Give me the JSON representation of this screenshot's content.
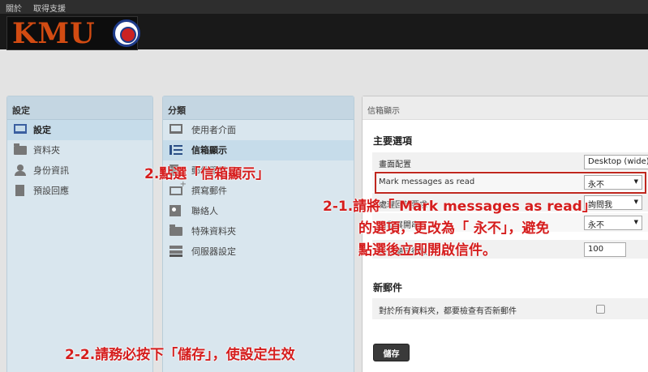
{
  "topbar": {
    "about": "關於",
    "support": "取得支援"
  },
  "logo": {
    "text": "KMU"
  },
  "settings_panel": {
    "title": "設定",
    "items": [
      {
        "label": "設定",
        "icon": "monitor-icon",
        "active": true
      },
      {
        "label": "資料夾",
        "icon": "folder-icon"
      },
      {
        "label": "身份資訊",
        "icon": "person-icon"
      },
      {
        "label": "預設回應",
        "icon": "document-icon"
      }
    ]
  },
  "sections_panel": {
    "title": "分類",
    "items": [
      {
        "label": "使用者介面",
        "icon": "monitor-icon"
      },
      {
        "label": "信箱顯示",
        "icon": "list-icon",
        "active": true
      },
      {
        "label": "郵件顯示",
        "icon": "document-icon"
      },
      {
        "label": "撰寫郵件",
        "icon": "compose-mail-icon"
      },
      {
        "label": "聯絡人",
        "icon": "contact-card-icon"
      },
      {
        "label": "特殊資料夾",
        "icon": "folder-icon"
      },
      {
        "label": "伺服器設定",
        "icon": "server-icon"
      }
    ]
  },
  "main_panel": {
    "title": "信箱顯示",
    "section1": "主要選項",
    "rows": [
      {
        "label": "畫面配置",
        "value": "Desktop (wide)"
      },
      {
        "label": "Mark messages as read",
        "value": "永不"
      },
      {
        "label": "處理回執要求",
        "value": "詢問我"
      },
      {
        "label": "自動展開串",
        "value": "永不"
      },
      {
        "label": "每頁顯示行數",
        "value": "100"
      }
    ],
    "section2": "新郵件",
    "new_mail_row": {
      "label": "對於所有資料夾，都要檢查有否新郵件",
      "checked": false
    },
    "save_label": "儲存"
  },
  "annotations": {
    "step2": "2.點選「信箱顯示」",
    "step21_l1": "2-1.請將「 Mark messages as read」",
    "step21_l2": "的選項，更改為「 永不」，避免",
    "step21_l3": "點選後立即開啟信件。",
    "step22": "2-2.請務必按下「儲存」，使設定生效"
  },
  "colors": {
    "annotation": "#d51d1d",
    "logo": "#d24b12",
    "panel": "#d9e6ee"
  }
}
